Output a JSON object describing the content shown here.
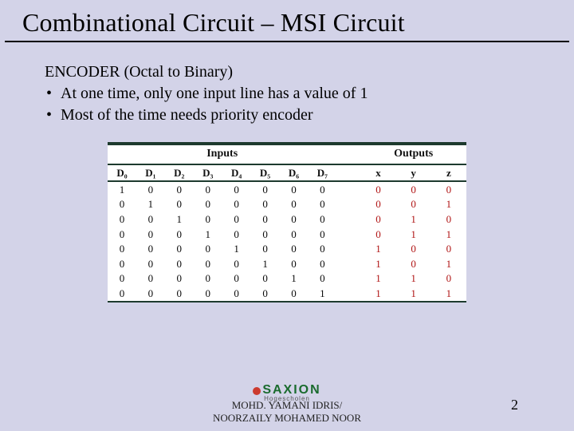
{
  "title": "Combinational Circuit – MSI Circuit",
  "subtitle": "ENCODER (Octal to Binary)",
  "bullets": [
    "At one time, only one input line has a value of 1",
    "Most of the time needs priority encoder"
  ],
  "chart_data": {
    "type": "table",
    "group_headers": {
      "inputs": "Inputs",
      "outputs": "Outputs"
    },
    "input_cols": [
      "D₀",
      "D₁",
      "D₂",
      "D₃",
      "D₄",
      "D₅",
      "D₆",
      "D₇"
    ],
    "output_cols": [
      "x",
      "y",
      "z"
    ],
    "rows": [
      {
        "in": [
          1,
          0,
          0,
          0,
          0,
          0,
          0,
          0
        ],
        "out": [
          0,
          0,
          0
        ]
      },
      {
        "in": [
          0,
          1,
          0,
          0,
          0,
          0,
          0,
          0
        ],
        "out": [
          0,
          0,
          1
        ]
      },
      {
        "in": [
          0,
          0,
          1,
          0,
          0,
          0,
          0,
          0
        ],
        "out": [
          0,
          1,
          0
        ]
      },
      {
        "in": [
          0,
          0,
          0,
          1,
          0,
          0,
          0,
          0
        ],
        "out": [
          0,
          1,
          1
        ]
      },
      {
        "in": [
          0,
          0,
          0,
          0,
          1,
          0,
          0,
          0
        ],
        "out": [
          1,
          0,
          0
        ]
      },
      {
        "in": [
          0,
          0,
          0,
          0,
          0,
          1,
          0,
          0
        ],
        "out": [
          1,
          0,
          1
        ]
      },
      {
        "in": [
          0,
          0,
          0,
          0,
          0,
          0,
          1,
          0
        ],
        "out": [
          1,
          1,
          0
        ]
      },
      {
        "in": [
          0,
          0,
          0,
          0,
          0,
          0,
          0,
          1
        ],
        "out": [
          1,
          1,
          1
        ]
      }
    ]
  },
  "footer": {
    "logo_main": "SAXION",
    "logo_sub": "Hogescholen",
    "author_line1": "MOHD. YAMANI IDRIS/",
    "author_line2": "NOORZAILY MOHAMED NOOR"
  },
  "page_number": "2"
}
